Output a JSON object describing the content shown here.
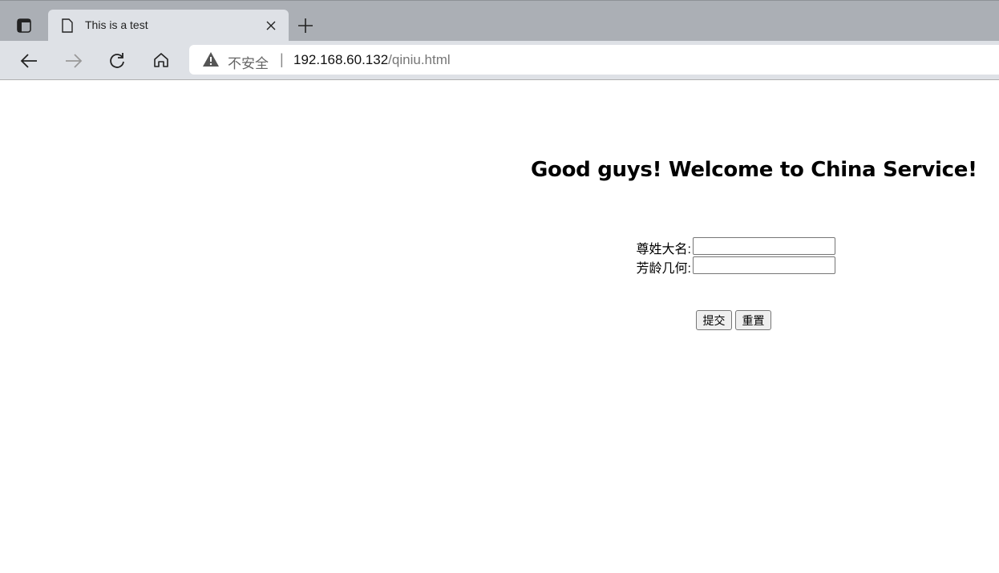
{
  "browser": {
    "tab_title": "This is a test",
    "security_label": "不安全",
    "separator": "|",
    "url_host": "192.168.60.132",
    "url_path": "/qiniu.html"
  },
  "page": {
    "heading": "Good guys! Welcome to China Service!",
    "name_label": "尊姓大名:",
    "name_value": "",
    "age_label": "芳龄几何:",
    "age_value": "",
    "submit_label": "提交",
    "reset_label": "重置"
  }
}
